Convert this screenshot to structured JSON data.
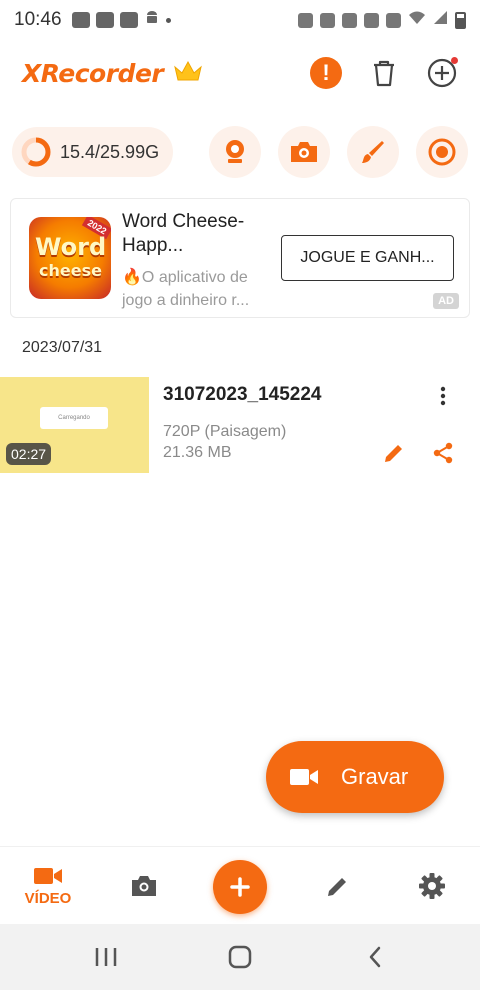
{
  "status_bar": {
    "time": "10:46"
  },
  "header": {
    "app_name": "XRecorder"
  },
  "toolbar": {
    "storage": "15.4/25.99G",
    "storage_used_fraction": 0.59
  },
  "ad": {
    "title": "Word Cheese-Happ...",
    "description": "🔥O aplicativo de jogo a dinheiro r...",
    "cta": "JOGUE E GANH...",
    "badge": "AD",
    "icon_text_1": "Word",
    "icon_text_2": "cheese",
    "icon_year": "2022"
  },
  "videos": {
    "date": "2023/07/31",
    "items": [
      {
        "name": "31072023_145224",
        "resolution": "720P (Paisagem)",
        "size": "21.36 MB",
        "duration": "02:27",
        "thumb_text": "Carregando"
      }
    ]
  },
  "record_button": {
    "label": "Gravar"
  },
  "bottom_nav": {
    "video_label": "VÍDEO"
  },
  "colors": {
    "accent": "#f46a12",
    "accent_light": "#fdf1ea"
  }
}
